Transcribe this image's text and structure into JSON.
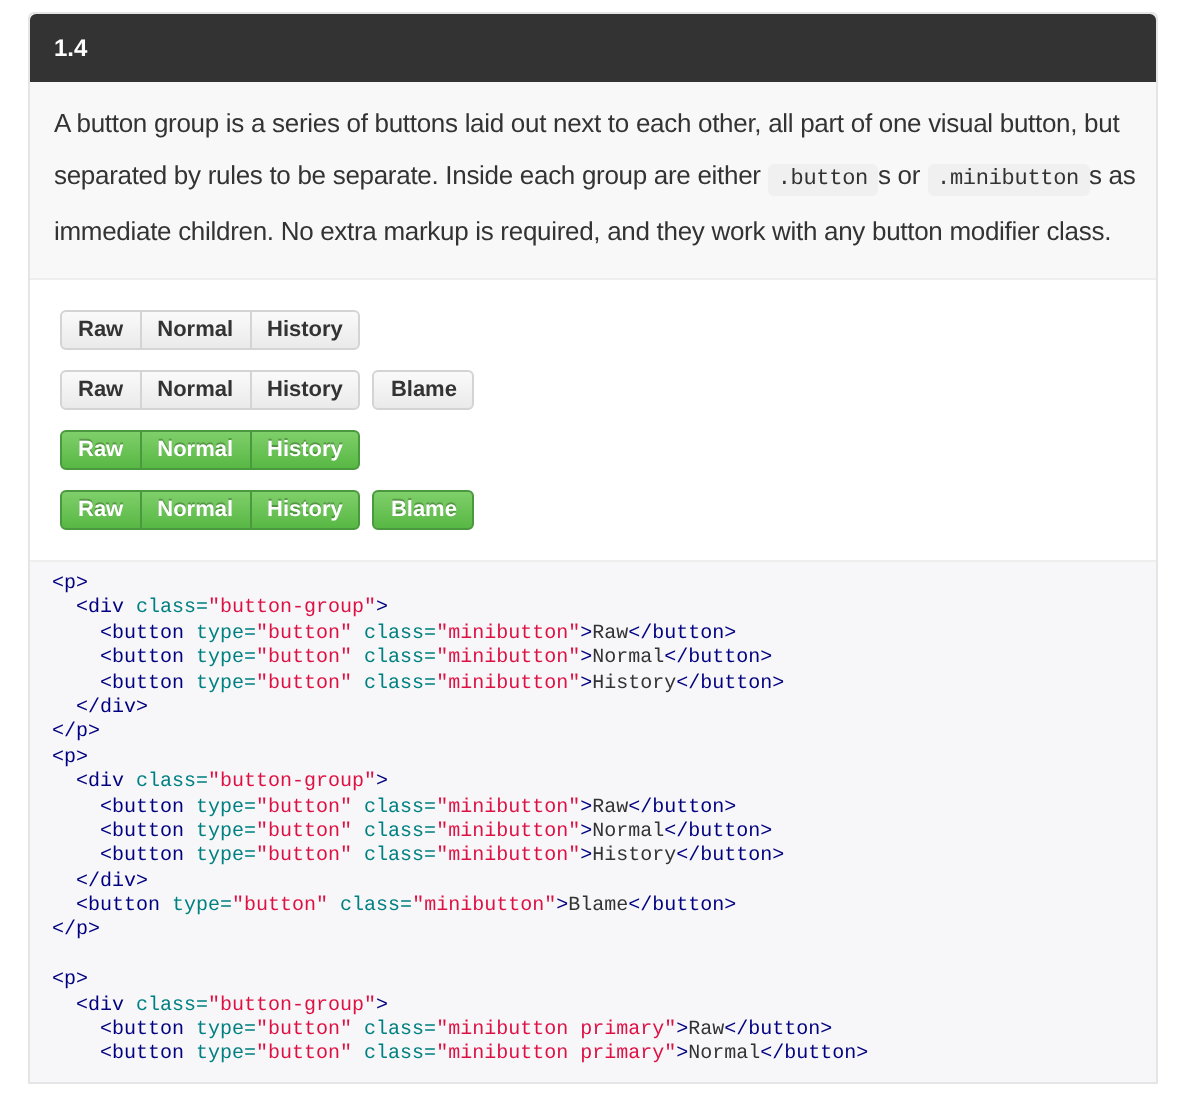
{
  "header": {
    "title": "1.4"
  },
  "description": [
    {
      "kind": "text",
      "text": "A button group is a series of buttons laid out next to each other, all part of one visual button, but separated by rules to be separate. Inside each group are either "
    },
    {
      "kind": "code",
      "text": ".button"
    },
    {
      "kind": "text",
      "text": "s or "
    },
    {
      "kind": "code",
      "text": ".minibutton"
    },
    {
      "kind": "text",
      "text": "s as immediate children. No extra markup is required, and they work with any button modifier class."
    }
  ],
  "examples": [
    {
      "kind": "default",
      "group": [
        "Raw",
        "Normal",
        "History"
      ]
    },
    {
      "kind": "default",
      "group": [
        "Raw",
        "Normal",
        "History"
      ],
      "extra": "Blame"
    },
    {
      "kind": "primary",
      "group": [
        "Raw",
        "Normal",
        "History"
      ]
    },
    {
      "kind": "primary",
      "group": [
        "Raw",
        "Normal",
        "History"
      ],
      "extra": "Blame"
    }
  ],
  "code_lines": [
    [
      {
        "kind": "tag",
        "text": "<p>"
      }
    ],
    [
      {
        "kind": "tag",
        "text": "  <div"
      },
      {
        "kind": "attr",
        "text": " class="
      },
      {
        "kind": "string",
        "text": "\"button-group\""
      },
      {
        "kind": "tag",
        "text": ">"
      }
    ],
    [
      {
        "kind": "tag",
        "text": "    <button"
      },
      {
        "kind": "attr",
        "text": " type="
      },
      {
        "kind": "string",
        "text": "\"button\""
      },
      {
        "kind": "attr",
        "text": " class="
      },
      {
        "kind": "string",
        "text": "\"minibutton\""
      },
      {
        "kind": "tag",
        "text": ">"
      },
      {
        "kind": "text",
        "text": "Raw"
      },
      {
        "kind": "tag",
        "text": "</button>"
      }
    ],
    [
      {
        "kind": "tag",
        "text": "    <button"
      },
      {
        "kind": "attr",
        "text": " type="
      },
      {
        "kind": "string",
        "text": "\"button\""
      },
      {
        "kind": "attr",
        "text": " class="
      },
      {
        "kind": "string",
        "text": "\"minibutton\""
      },
      {
        "kind": "tag",
        "text": ">"
      },
      {
        "kind": "text",
        "text": "Normal"
      },
      {
        "kind": "tag",
        "text": "</button>"
      }
    ],
    [
      {
        "kind": "tag",
        "text": "    <button"
      },
      {
        "kind": "attr",
        "text": " type="
      },
      {
        "kind": "string",
        "text": "\"button\""
      },
      {
        "kind": "attr",
        "text": " class="
      },
      {
        "kind": "string",
        "text": "\"minibutton\""
      },
      {
        "kind": "tag",
        "text": ">"
      },
      {
        "kind": "text",
        "text": "History"
      },
      {
        "kind": "tag",
        "text": "</button>"
      }
    ],
    [
      {
        "kind": "tag",
        "text": "  </div>"
      }
    ],
    [
      {
        "kind": "tag",
        "text": "</p>"
      }
    ],
    [
      {
        "kind": "tag",
        "text": "<p>"
      }
    ],
    [
      {
        "kind": "tag",
        "text": "  <div"
      },
      {
        "kind": "attr",
        "text": " class="
      },
      {
        "kind": "string",
        "text": "\"button-group\""
      },
      {
        "kind": "tag",
        "text": ">"
      }
    ],
    [
      {
        "kind": "tag",
        "text": "    <button"
      },
      {
        "kind": "attr",
        "text": " type="
      },
      {
        "kind": "string",
        "text": "\"button\""
      },
      {
        "kind": "attr",
        "text": " class="
      },
      {
        "kind": "string",
        "text": "\"minibutton\""
      },
      {
        "kind": "tag",
        "text": ">"
      },
      {
        "kind": "text",
        "text": "Raw"
      },
      {
        "kind": "tag",
        "text": "</button>"
      }
    ],
    [
      {
        "kind": "tag",
        "text": "    <button"
      },
      {
        "kind": "attr",
        "text": " type="
      },
      {
        "kind": "string",
        "text": "\"button\""
      },
      {
        "kind": "attr",
        "text": " class="
      },
      {
        "kind": "string",
        "text": "\"minibutton\""
      },
      {
        "kind": "tag",
        "text": ">"
      },
      {
        "kind": "text",
        "text": "Normal"
      },
      {
        "kind": "tag",
        "text": "</button>"
      }
    ],
    [
      {
        "kind": "tag",
        "text": "    <button"
      },
      {
        "kind": "attr",
        "text": " type="
      },
      {
        "kind": "string",
        "text": "\"button\""
      },
      {
        "kind": "attr",
        "text": " class="
      },
      {
        "kind": "string",
        "text": "\"minibutton\""
      },
      {
        "kind": "tag",
        "text": ">"
      },
      {
        "kind": "text",
        "text": "History"
      },
      {
        "kind": "tag",
        "text": "</button>"
      }
    ],
    [
      {
        "kind": "tag",
        "text": "  </div>"
      }
    ],
    [
      {
        "kind": "tag",
        "text": "  <button"
      },
      {
        "kind": "attr",
        "text": " type="
      },
      {
        "kind": "string",
        "text": "\"button\""
      },
      {
        "kind": "attr",
        "text": " class="
      },
      {
        "kind": "string",
        "text": "\"minibutton\""
      },
      {
        "kind": "tag",
        "text": ">"
      },
      {
        "kind": "text",
        "text": "Blame"
      },
      {
        "kind": "tag",
        "text": "</button>"
      }
    ],
    [
      {
        "kind": "tag",
        "text": "</p>"
      }
    ],
    [
      {
        "kind": "blank"
      }
    ],
    [
      {
        "kind": "tag",
        "text": "<p>"
      }
    ],
    [
      {
        "kind": "tag",
        "text": "  <div"
      },
      {
        "kind": "attr",
        "text": " class="
      },
      {
        "kind": "string",
        "text": "\"button-group\""
      },
      {
        "kind": "tag",
        "text": ">"
      }
    ],
    [
      {
        "kind": "tag",
        "text": "    <button"
      },
      {
        "kind": "attr",
        "text": " type="
      },
      {
        "kind": "string",
        "text": "\"button\""
      },
      {
        "kind": "attr",
        "text": " class="
      },
      {
        "kind": "string",
        "text": "\"minibutton primary\""
      },
      {
        "kind": "tag",
        "text": ">"
      },
      {
        "kind": "text",
        "text": "Raw"
      },
      {
        "kind": "tag",
        "text": "</button>"
      }
    ],
    [
      {
        "kind": "tag",
        "text": "    <button"
      },
      {
        "kind": "attr",
        "text": " type="
      },
      {
        "kind": "string",
        "text": "\"button\""
      },
      {
        "kind": "attr",
        "text": " class="
      },
      {
        "kind": "string",
        "text": "\"minibutton primary\""
      },
      {
        "kind": "tag",
        "text": ">"
      },
      {
        "kind": "text",
        "text": "Normal"
      },
      {
        "kind": "tag",
        "text": "</button>"
      }
    ]
  ]
}
